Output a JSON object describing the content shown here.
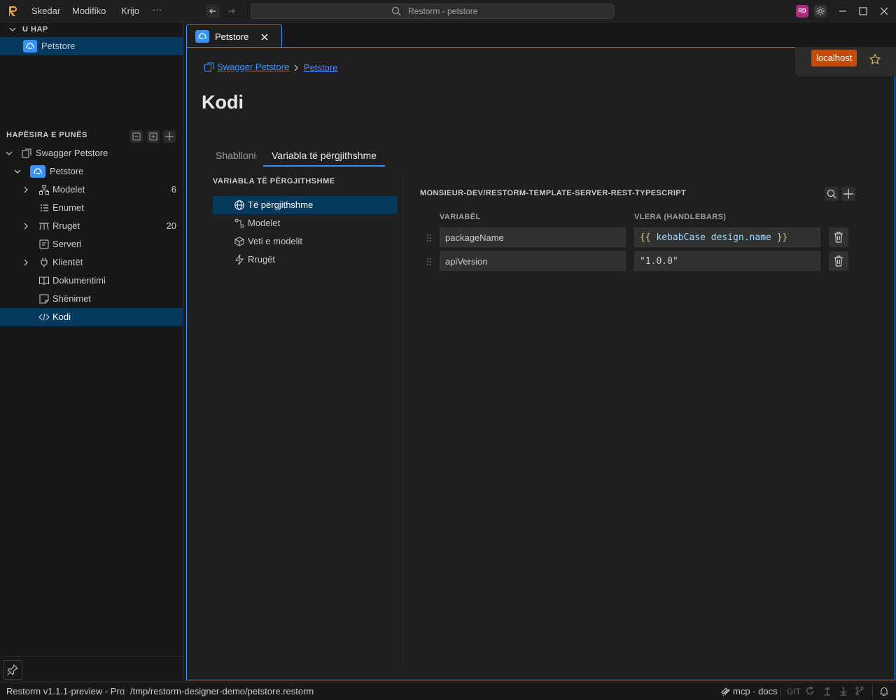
{
  "app": {
    "menu": [
      "Skedar",
      "Modifiko",
      "Krijo",
      "···"
    ],
    "search_text": "Restorm - petstore",
    "avatar_initials": "RD"
  },
  "sidebar": {
    "open_section": "U HAP",
    "open_items": [
      {
        "label": "Petstore"
      }
    ],
    "workspace_section": "HAPËSIRA E PUNËS",
    "tree": [
      {
        "label": "Swagger Petstore"
      },
      {
        "label": "Petstore"
      },
      {
        "label": "Modelet",
        "count": "6"
      },
      {
        "label": "Enumet"
      },
      {
        "label": "Rrugët",
        "count": "20"
      },
      {
        "label": "Serveri"
      },
      {
        "label": "Klientët"
      },
      {
        "label": "Dokumentimi"
      },
      {
        "label": "Shënimet"
      },
      {
        "label": "Kodi"
      }
    ]
  },
  "tab": {
    "label": "Petstore"
  },
  "breadcrumb": {
    "root": "Swagger Petstore",
    "current": "Petstore"
  },
  "env": {
    "label": "localhost"
  },
  "page": {
    "title": "Kodi"
  },
  "subtabs": [
    "Shablloni",
    "Variabla të përgjithshme"
  ],
  "left_panel": {
    "heading": "VARIABLA TË PËRGJITHSHME",
    "items": [
      {
        "label": "Të përgjithshme"
      },
      {
        "label": "Modelet"
      },
      {
        "label": "Veti e modelit"
      },
      {
        "label": "Rrugët"
      }
    ]
  },
  "right_panel": {
    "heading": "MONSIEUR-DEV/RESTORM-TEMPLATE-SERVER-REST-TYPESCRIPT",
    "col_variable": "VARIABËL",
    "col_value": "VLERA (HANDLEBARS)",
    "rows": [
      {
        "name": "packageName",
        "open": "{{",
        "helper": "kebabCase",
        "arg": "design.name",
        "close": "}}"
      },
      {
        "name": "apiVersion",
        "value": "\"1.0.0\""
      }
    ]
  },
  "status": {
    "version": "Restorm v1.1.1-preview - Pro",
    "path": "/tmp/restorm-designer-demo/petstore.restorm",
    "mcp": "mcp · docs",
    "git": "GIT"
  },
  "colors": {
    "accent": "#3794ff",
    "selection": "#04395e",
    "env_badge": "#c44b0a",
    "handlebars_brace": "#e5c07b",
    "handlebars_text": "#9cdcfe"
  }
}
